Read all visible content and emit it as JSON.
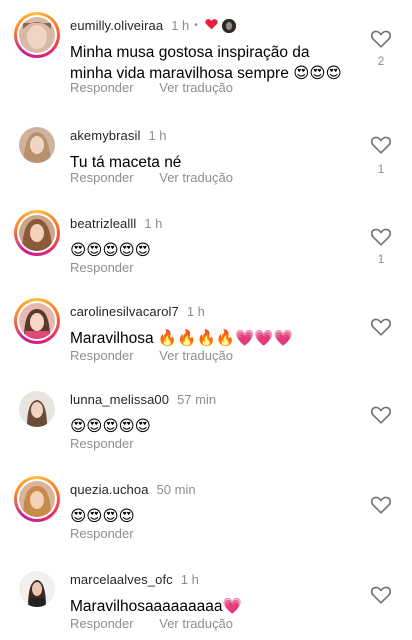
{
  "labels": {
    "reply": "Responder",
    "translate": "Ver tradução"
  },
  "comments": [
    {
      "username": "eumilly.oliveiraa",
      "time": "1 h",
      "dot": "•",
      "text": "Minha musa gostosa inspiração da minha vida maravilhosa sempre 😍😍😍",
      "likes": "2"
    },
    {
      "username": "akemybrasil",
      "time": "1 h",
      "text": "Tu tá maceta né",
      "likes": "1"
    },
    {
      "username": "beatrizlealll",
      "time": "1 h",
      "text": "😍😍😍😍😍",
      "likes": "1"
    },
    {
      "username": "carolinesilvacarol7",
      "time": "1 h",
      "text": "Maravilhosa 🔥🔥🔥🔥💗💗💗",
      "likes": ""
    },
    {
      "username": "lunna_melissa00",
      "time": "57 min",
      "text": "😍😍😍😍😍",
      "likes": ""
    },
    {
      "username": "quezia.uchoa",
      "time": "50 min",
      "text": "😍😍😍😍",
      "likes": ""
    },
    {
      "username": "marcelaalves_ofc",
      "time": "1 h",
      "text": "Maravilhosaaaaaaaaa💗",
      "likes": ""
    }
  ]
}
